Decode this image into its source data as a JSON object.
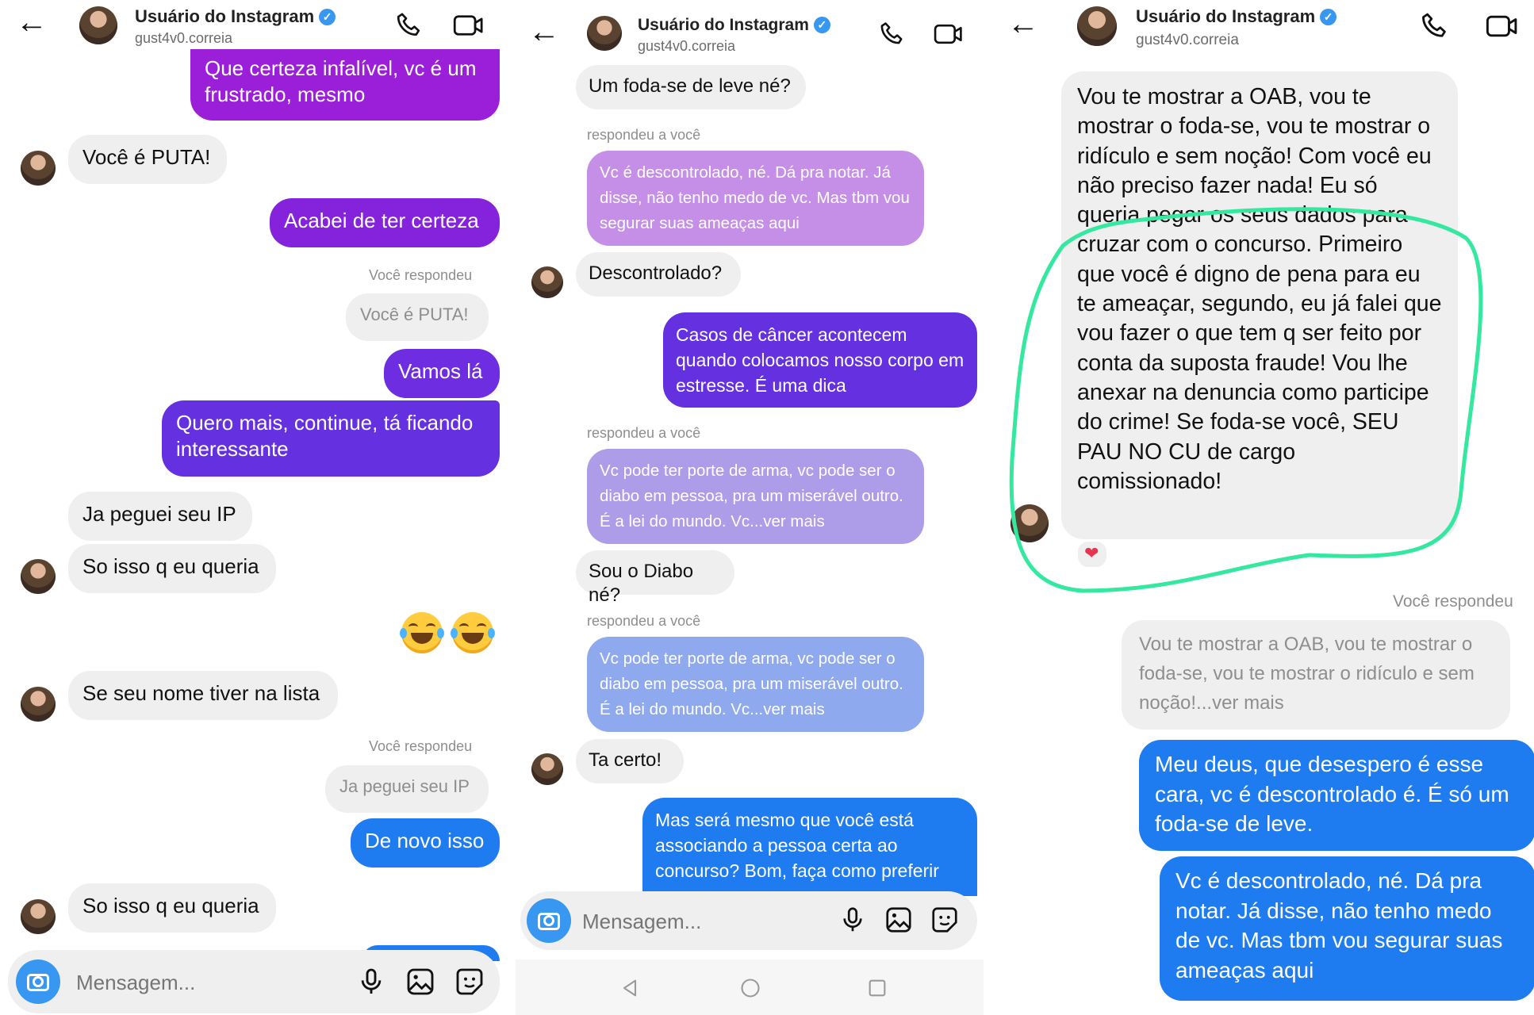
{
  "header": {
    "name": "Usuário do Instagram",
    "username": "gust4v0.correia",
    "verified_icon": "✓"
  },
  "colors": {
    "purple": "#9b1fd9",
    "violet": "#6a2fe0",
    "blue": "#1e7cf0",
    "highlight": "#35e8a0"
  },
  "panel1": {
    "messages": [
      "Que certeza infalível, vc é um frustrado, mesmo",
      "Você é PUTA!",
      "Acabei de ter certeza",
      "Você é PUTA!",
      "Vamos lá",
      "Quero mais, continue, tá ficando interessante",
      "Ja peguei seu IP",
      "So isso q eu queria",
      "Se seu nome tiver na lista",
      "Ja peguei seu IP",
      "De novo isso",
      "So isso q eu queria"
    ],
    "reply_label_1": "Você respondeu",
    "reply_label_2": "Você respondeu",
    "emoji": "😂😂"
  },
  "panel2": {
    "messages": [
      "Um foda-se de leve né?",
      "Vc é descontrolado, né. Dá pra notar. Já disse, não tenho medo de vc. Mas tbm vou segurar suas ameaças aqui",
      "Descontrolado?",
      "Casos de câncer acontecem quando colocamos nosso corpo em estresse. É uma dica",
      "Vc pode ter porte de arma, vc pode ser o diabo em pessoa, pra um miserável outro. É a lei do mundo. Vc...ver mais",
      "Sou o Diabo né?",
      "Vc pode ter porte de arma, vc pode ser o diabo em pessoa, pra um miserável outro. É a lei do mundo. Vc...ver mais",
      "Ta certo!",
      "Mas será mesmo que você está associando a pessoa certa ao concurso? Bom, faça como preferir"
    ],
    "reply_label_1": "respondeu a você",
    "reply_label_2": "respondeu a você",
    "reply_label_3": "respondeu a você"
  },
  "panel3": {
    "messages": [
      "Vou te mostrar a OAB, vou te mostrar o foda-se, vou te mostrar o ridículo e sem noção! Com você eu não preciso fazer nada! Eu só queria pegar os seus dados para cruzar com o concurso. Primeiro que você é digno de pena para eu te ameaçar, segundo, eu já falei que vou fazer o que tem q ser feito por conta da suposta fraude! Vou lhe anexar na denuncia como participe do crime! Se foda-se você, SEU PAU NO CU de cargo comissionado!",
      "Vou te mostrar a OAB, vou te mostrar o foda-se, vou te mostrar o ridículo e sem noção!...ver mais",
      "Meu deus, que desespero é esse cara, vc é descontrolado é. É só um foda-se de leve.",
      "Vc é descontrolado, né. Dá pra notar. Já disse, não tenho medo de vc. Mas tbm vou segurar suas ameaças aqui"
    ],
    "reply_label": "Você respondeu",
    "reaction": "❤"
  },
  "composer": {
    "placeholder": "Mensagem..."
  }
}
